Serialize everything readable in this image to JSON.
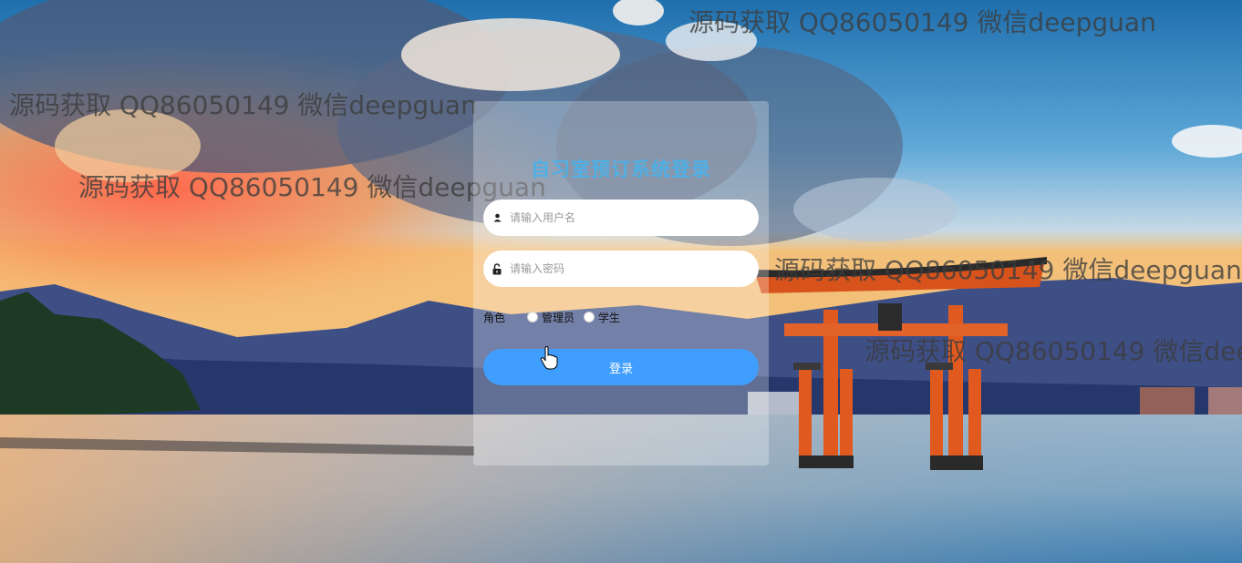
{
  "login": {
    "title": "自习室预订系统登录",
    "username_placeholder": "请输入用户名",
    "password_placeholder": "请输入密码",
    "role_label": "角色",
    "roles": [
      "管理员",
      "学生"
    ],
    "submit_label": "登录"
  },
  "watermark": {
    "text": "源码获取 QQ86050149 微信deepguan"
  },
  "colors": {
    "accent": "#409eff",
    "title": "#4fb0e6"
  },
  "icons": {
    "user": "user-icon",
    "lock": "lock-icon"
  }
}
